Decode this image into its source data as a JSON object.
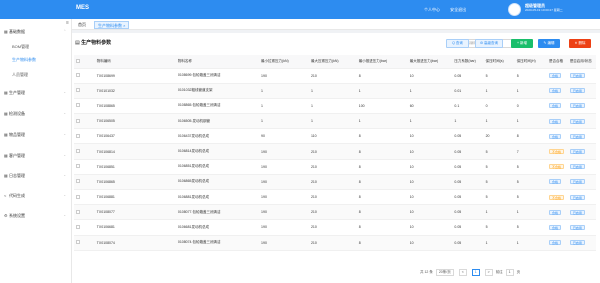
{
  "app": {
    "logo": "MES"
  },
  "header": {
    "links": [
      "个人中心",
      "安全退出"
    ],
    "user_name": "超级管理员",
    "user_date": "2020-05-19 10:00:27 星期二"
  },
  "sidebar": {
    "collapse_icon": "menu-fold-icon",
    "items": [
      {
        "label": "基础数据",
        "icon": "grid-icon",
        "expanded": true
      },
      {
        "label": "生产管理",
        "icon": "grid-icon",
        "expanded": false
      },
      {
        "label": "检测设备",
        "icon": "grid-icon",
        "expanded": false
      },
      {
        "label": "物品管理",
        "icon": "grid-icon",
        "expanded": false
      },
      {
        "label": "客户管理",
        "icon": "grid-icon",
        "expanded": false
      },
      {
        "label": "日志管理",
        "icon": "grid-icon",
        "expanded": false
      },
      {
        "label": "代码生成",
        "icon": "code-icon",
        "expanded": false
      },
      {
        "label": "系统设置",
        "icon": "gear-icon",
        "expanded": false
      }
    ],
    "sub_items": [
      {
        "label": "BOM管理",
        "active": false
      },
      {
        "label": "生产物料参数",
        "active": true
      },
      {
        "label": "人员管理",
        "active": false
      }
    ]
  },
  "tabs": [
    {
      "label": "首页",
      "active": false
    },
    {
      "label": "生产物料参数",
      "active": true,
      "close": "×"
    }
  ],
  "panel": {
    "title": "生产物料参数",
    "search_placeholder": "物料编码",
    "buttons": {
      "search": "Q 查询",
      "advanced": "⚙ 高级查询",
      "add": "+ 新增",
      "edit": "✎ 编辑",
      "delete": "✕ 删除"
    }
  },
  "table": {
    "columns": [
      "物料编码",
      "物料名称",
      "最小拉紧压力(kN)",
      "最大压紧压力(kN)",
      "最小推进压力(bar)",
      "最大推进压力(bar)",
      "压力系数(bar)",
      "保压时间(s)",
      "保压时间(H)",
      "是否合格",
      "是否启用/状态"
    ],
    "rows": [
      [
        "TX0108699",
        "0108699.包轮箱盖三闭清洁",
        "190",
        "210",
        "8",
        "10",
        "0.05",
        "5",
        "5",
        "合格",
        "已启用"
      ],
      [
        "TX0101032",
        "0101032粗线管道支架",
        "1",
        "1",
        "1",
        "1",
        "0.01",
        "1",
        "1",
        "合格",
        "已启用"
      ],
      [
        "TX0108865",
        "0108865.包轮箱盖三闭清洁",
        "1",
        "1",
        "100",
        "60",
        "0.1",
        "0",
        "0",
        "合格",
        "已启用"
      ],
      [
        "TX0106505",
        "0106505.发动机钢管",
        "1",
        "1",
        "1",
        "1",
        "1",
        "1",
        "1",
        "合格",
        "已启用"
      ],
      [
        "TX0106437",
        "0106437发动机总成",
        "90",
        "110",
        "8",
        "10",
        "0.05",
        "20",
        "8",
        "合格",
        "已启用"
      ],
      [
        "TX0106814",
        "0106814发动机总成",
        "190",
        "210",
        "8",
        "10",
        "0.05",
        "5",
        "7",
        "不合格",
        "已启用"
      ],
      [
        "TX0106851",
        "0106851发动机总成",
        "190",
        "210",
        "8",
        "10",
        "0.05",
        "5",
        "5",
        "不合格",
        "已启用"
      ],
      [
        "TX0106865",
        "0106865发动机总成",
        "190",
        "210",
        "8",
        "10",
        "0.05",
        "5",
        "5",
        "合格",
        "已启用"
      ],
      [
        "TX0106881",
        "0106881发动机总成",
        "190",
        "210",
        "8",
        "10",
        "0.05",
        "5",
        "5",
        "不合格",
        "已启用"
      ],
      [
        "TX0108077",
        "0108077.包轮箱盖三闭清洁",
        "190",
        "210",
        "8",
        "10",
        "0.05",
        "1",
        "1",
        "合格",
        "已启用"
      ],
      [
        "TX0106681",
        "0106681发动机总成",
        "190",
        "210",
        "8",
        "10",
        "0.05",
        "5",
        "5",
        "合格",
        "已启用"
      ],
      [
        "TX0108074",
        "0108074.包轮箱盖三闭清洁",
        "190",
        "210",
        "8",
        "10",
        "0.05",
        "1",
        "1",
        "合格",
        "已启用"
      ]
    ]
  },
  "pager": {
    "total": "共 12 条",
    "page_size": "20条/页",
    "prev": "<",
    "current": "1",
    "next": ">",
    "goto": "前往",
    "goto_value": "1",
    "page_unit": "页"
  }
}
